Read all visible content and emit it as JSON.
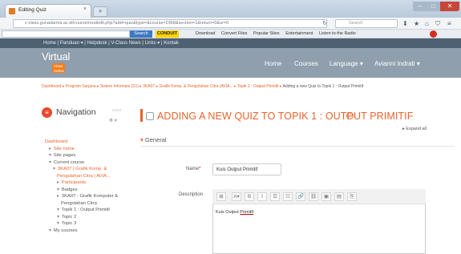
{
  "browser": {
    "tab_title": "Editing Quiz",
    "url": "v-class.gunadarma.ac.id/course/modedit.php?add=quiz&type=&course=2968&section=1&return=0&sr=0",
    "search_placeholder": "Search",
    "toolbar_search_button": "Search",
    "toolbar_links": [
      "Download",
      "Convert Files",
      "Popular Sites",
      "Entertainment",
      "Listen to the Radio"
    ],
    "conduit_label": "CONDUIT"
  },
  "site": {
    "topline": "Home | Panduan ▾ | Helpdesk | V-Class News | Links ▾ | Kontak",
    "logo_main": "Virtual",
    "logo_sub1": "Class",
    "logo_sub2": "Online",
    "menu": [
      "Home",
      "Courses",
      "Language ▾",
      "Avianni Indrati ▾"
    ],
    "breadcrumb": "Dashboard ▸ Program Sarjana ▸ Sistem Informasi (S1) ▸ 3KA07 ▸ Grafik Komp. & Pengolahan Citra (AVIA... ▸ Topik 1 : Output Primitif ▸",
    "breadcrumb_current": "Adding a new Quiz to Topik 1 : Output Primitif"
  },
  "navigation": {
    "title": "Navigation",
    "items": [
      {
        "label": "Dashboard",
        "indent": 0,
        "bullet": "",
        "color": "#e8632b"
      },
      {
        "label": "Site home",
        "indent": 1,
        "bullet": "▸",
        "color": "#e8632b"
      },
      {
        "label": "Site pages",
        "indent": 1,
        "bullet": "▾",
        "color": "#555555"
      },
      {
        "label": "Current course",
        "indent": 1,
        "bullet": "▾",
        "color": "#555555"
      },
      {
        "label": "3KA07 | Grafik Komp. &",
        "indent": 2,
        "bullet": "▾",
        "color": "#e8632b"
      },
      {
        "label": "Pengolahan Citra | AVIA...",
        "indent": 3,
        "bullet": "",
        "color": "#e8632b"
      },
      {
        "label": "Participants",
        "indent": 3,
        "bullet": "▸",
        "color": "#e8632b"
      },
      {
        "label": "Badges",
        "indent": 3,
        "bullet": "▾",
        "color": "#555555"
      },
      {
        "label": "3KA07 - Grafik Komputer &",
        "indent": 3,
        "bullet": "▸",
        "color": "#555555"
      },
      {
        "label": "Pengolahan Citra",
        "indent": 4,
        "bullet": "",
        "color": "#555555"
      },
      {
        "label": "Topik 1 : Output Primitif",
        "indent": 3,
        "bullet": "▾",
        "color": "#555555"
      },
      {
        "label": "Topic 2",
        "indent": 3,
        "bullet": "▾",
        "color": "#555555"
      },
      {
        "label": "Topic 3",
        "indent": 3,
        "bullet": "▾",
        "color": "#555555"
      },
      {
        "label": "My courses",
        "indent": 1,
        "bullet": "▾",
        "color": "#555555"
      }
    ]
  },
  "main": {
    "page_title": "ADDING A NEW QUIZ TO TOPIK 1 : OUTPUT PRIMITIF",
    "expand_all": "Expand all",
    "section_general": "General",
    "name_label": "Name",
    "name_required": "*",
    "name_value": "Kuis Output Primitif",
    "description_label": "Description",
    "description_text": "Kuis Output ",
    "description_text_underlined": "Primitif",
    "editor_buttons": [
      "⊞",
      "A▾",
      "B",
      "I",
      "☰",
      "☷",
      "🔗",
      "⛓",
      "▣",
      "▤",
      "⎘"
    ]
  },
  "colors": {
    "accent": "#e8632b",
    "header": "#8f9fae",
    "topline": "#4e6172"
  }
}
